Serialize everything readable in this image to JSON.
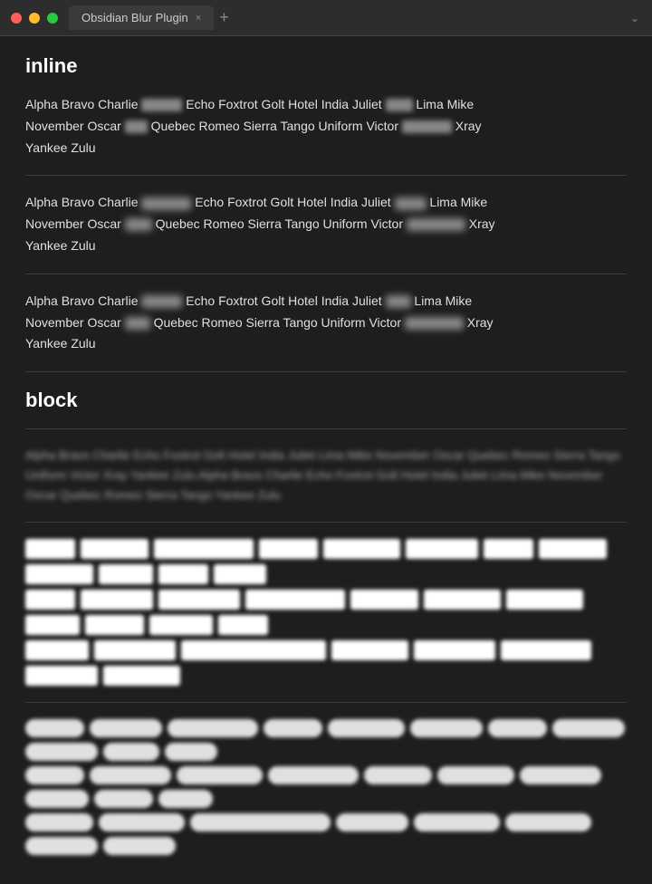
{
  "titlebar": {
    "tab_label": "Obsidian Blur Plugin",
    "tab_close": "×",
    "tab_add": "+",
    "tab_chevron": "⌄"
  },
  "section_inline": {
    "title": "inline",
    "paragraphs": [
      {
        "id": "p1",
        "words": "Alpha Bravo Charlie [blur:45] Echo Foxtrot Golt Hotel India Juliet [blur:30] Lima Mike November Oscar [blur:25] Quebec Romeo Sierra Tango Uniform Victor [blur:55] Xray Yankee Zulu"
      },
      {
        "id": "p2",
        "words": "Alpha Bravo Charlie [blur:55] Echo Foxtrot Golt Hotel India Juliet [blur:35] Lima Mike November Oscar [blur:30] Quebec Romeo Sierra Tango Uniform Victor [blur:65] Xray Yankee Zulu"
      },
      {
        "id": "p3",
        "words": "Alpha Bravo Charlie [blur:45] Echo Foxtrot Golt Hotel India Juliet [blur:28] Lima Mike November Oscar [blur:28] Quebec Romeo Sierra Tango Uniform Victor [blur:65] Xray Yankee Zulu"
      }
    ]
  },
  "section_block": {
    "title": "block",
    "blurred_text": "Alpha Bravo Charlie Echo Foxtrot Golt Hotel India Juliet Lima Mike November Oscar Quebec Romeo Sierra Tango Uniform Victor Xray Yankee Zulu Alpha Bravo Charlie Echo Foxtrot Golt Hotel India Juliet Lima Mike November Oscar Quebec Romeo Sierra Tango Yankee Zulu"
  },
  "block_rows_sharp": [
    [
      55,
      75,
      120,
      65,
      85,
      95,
      55,
      85,
      95,
      60,
      55,
      65
    ],
    [
      55,
      80,
      100,
      120,
      75,
      85,
      95,
      60,
      65,
      70,
      55
    ],
    [
      70,
      90,
      175,
      85,
      95,
      110,
      80,
      90,
      85
    ]
  ],
  "block_rows_rounded": [
    [
      65,
      80,
      110,
      65,
      85,
      95,
      65,
      85,
      95,
      70,
      65,
      60
    ],
    [
      65,
      90,
      100,
      110,
      75,
      90,
      95,
      70,
      65,
      75,
      65
    ],
    [
      75,
      95,
      165,
      80,
      95,
      100,
      75,
      85,
      90
    ]
  ]
}
